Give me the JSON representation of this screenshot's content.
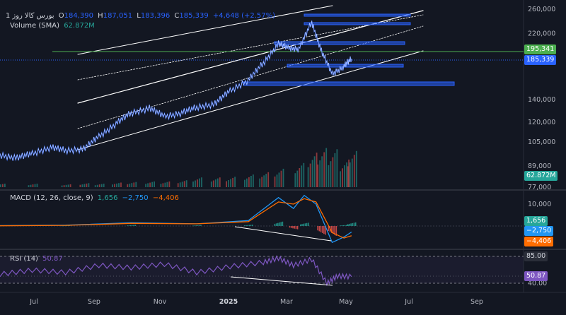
{
  "header": {
    "symbol": "بورس كالا",
    "interval": "1",
    "timeframe": "روز",
    "ohlc": {
      "open_label": "O",
      "open": "184,390",
      "high_label": "H",
      "high": "187,051",
      "low_label": "L",
      "low": "183,396",
      "close_label": "C",
      "close": "185,339",
      "change": "+4,648 (+2.57%)"
    },
    "volume_label": "Volume (SMA)",
    "volume_value": "62.872M"
  },
  "macd_legend": {
    "label": "MACD (12, 26, close, 9)",
    "hist": "1,656",
    "macd": "−2,750",
    "signal": "−4,406"
  },
  "rsi_legend": {
    "label": "RSI (14)",
    "value": "50.87"
  },
  "price_tags": {
    "green_line": "195,341",
    "last_price": "185,339",
    "volume": "62.872M"
  },
  "macd_tags": {
    "hist": "1,656",
    "macd": "−2,750",
    "signal": "−4,406"
  },
  "rsi_tags": {
    "upper": "85.00",
    "value": "50.87"
  },
  "colors": {
    "background": "#131722",
    "text": "#d1d4dc",
    "price_line": "#2962ff",
    "up": "#26a69a",
    "down": "#ef5350",
    "macd": "#2196f3",
    "signal": "#ff6d00",
    "rsi": "#7e57c2",
    "green_line": "#4caf50"
  },
  "chart_data": [
    {
      "type": "line",
      "title": "بورس كالا",
      "x_ticks": [
        "Jul",
        "Sep",
        "Nov",
        "2025",
        "Mar",
        "May",
        "Jul",
        "Sep"
      ],
      "x_range": [
        "2024-06-15",
        "2025-10-15"
      ],
      "y_scale": "log",
      "y_ticks": [
        77000,
        89000,
        105000,
        120000,
        140000,
        220000,
        260000
      ],
      "ylim": [
        77000,
        260000
      ],
      "series": [
        {
          "x": [
            "2024-06-15",
            "2024-07-01",
            "2024-07-15",
            "2024-08-01",
            "2024-08-15",
            "2024-09-01",
            "2024-09-15",
            "2024-10-01",
            "2024-10-15",
            "2024-11-01",
            "2024-11-15",
            "2024-12-01",
            "2024-12-15",
            "2025-01-01",
            "2025-01-15",
            "2025-02-01",
            "2025-02-15",
            "2025-03-01",
            "2025-03-10",
            "2025-03-20",
            "2025-04-01",
            "2025-04-10",
            "2025-04-20",
            "2025-05-01",
            "2025-05-08"
          ],
          "values": [
            96000,
            94000,
            97000,
            101000,
            99000,
            100000,
            109000,
            119000,
            128000,
            132000,
            125000,
            128000,
            133000,
            136000,
            149000,
            160000,
            180000,
            205000,
            200000,
            198000,
            238000,
            195000,
            167000,
            176000,
            185339
          ]
        }
      ],
      "horizontal_levels": [
        195341,
        185339
      ],
      "volume_bars": {
        "values_M": [
          6,
          6,
          5,
          7,
          6,
          8,
          9,
          10,
          10,
          12,
          17,
          17,
          18,
          22,
          26,
          32,
          42,
          60,
          68,
          66,
          48,
          62.872
        ],
        "x": [
          "2024-06-15",
          "2024-07-15",
          "2024-08-15",
          "2024-09-01",
          "2024-09-15",
          "2024-10-01",
          "2024-10-15",
          "2024-11-01",
          "2024-11-15",
          "2024-12-01",
          "2024-12-15",
          "2025-01-01",
          "2025-01-15",
          "2025-02-01",
          "2025-02-15",
          "2025-03-01",
          "2025-03-20",
          "2025-04-01",
          "2025-04-10",
          "2025-04-20",
          "2025-05-01",
          "2025-05-08"
        ]
      }
    },
    {
      "type": "line",
      "title": "MACD (12, 26, close, 9)",
      "y_ticks": [
        10000
      ],
      "series": [
        {
          "name": "MACD",
          "x": [
            "2024-06-15",
            "2024-08-15",
            "2024-10-15",
            "2024-12-15",
            "2025-02-01",
            "2025-03-01",
            "2025-03-15",
            "2025-03-25",
            "2025-04-05",
            "2025-04-20",
            "2025-05-01",
            "2025-05-08"
          ],
          "values": [
            200,
            400,
            1500,
            1000,
            2500,
            13000,
            8000,
            14000,
            10000,
            -7500,
            -5000,
            -2750
          ]
        },
        {
          "name": "Signal",
          "x": [
            "2024-06-15",
            "2024-08-15",
            "2024-10-15",
            "2024-12-15",
            "2025-02-01",
            "2025-03-01",
            "2025-03-15",
            "2025-03-25",
            "2025-04-05",
            "2025-04-20",
            "2025-05-01",
            "2025-05-08"
          ],
          "values": [
            100,
            300,
            1200,
            1000,
            2000,
            11000,
            10000,
            12500,
            11000,
            -3000,
            -5500,
            -4406
          ]
        },
        {
          "name": "Histogram",
          "x": [
            "2024-08-15",
            "2024-10-15",
            "2024-12-15",
            "2025-02-01",
            "2025-03-01",
            "2025-03-15",
            "2025-03-25",
            "2025-04-10",
            "2025-04-20",
            "2025-05-01",
            "2025-05-08"
          ],
          "values": [
            300,
            500,
            400,
            600,
            2000,
            -1500,
            1500,
            -4000,
            -4500,
            500,
            1656
          ]
        }
      ]
    },
    {
      "type": "line",
      "title": "RSI (14)",
      "y_ticks": [
        40,
        85
      ],
      "ylim": [
        35,
        90
      ],
      "series": [
        {
          "x": [
            "2024-06-15",
            "2024-07-15",
            "2024-08-15",
            "2024-09-15",
            "2024-10-15",
            "2024-11-15",
            "2024-12-15",
            "2025-01-15",
            "2025-02-15",
            "2025-03-01",
            "2025-03-15",
            "2025-04-01",
            "2025-04-15",
            "2025-04-25",
            "2025-05-08"
          ],
          "values": [
            55,
            62,
            58,
            70,
            66,
            72,
            58,
            68,
            75,
            82,
            70,
            80,
            40,
            52,
            50.87
          ]
        }
      ]
    }
  ]
}
